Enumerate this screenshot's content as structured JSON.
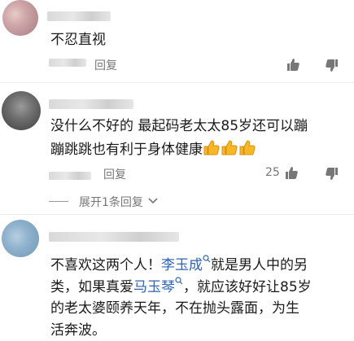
{
  "comments": [
    {
      "text_lines": [
        "不忍直视"
      ],
      "reply_label": "回复",
      "like_count": ""
    },
    {
      "text_lines": [
        "没什么不好的 最起码老太太85岁还可以蹦",
        "蹦跳跳也有利于身体健康"
      ],
      "reply_label": "回复",
      "like_count": "25",
      "emoji": [
        "thumbs-up",
        "thumbs-up",
        "thumbs-up"
      ]
    },
    {
      "line1_a": "不喜欢这两个人！",
      "mention1": "李玉成",
      "line1_b": "就是男人中的另",
      "line2_a": "类，如果真爱",
      "mention2": "马玉琴",
      "line2_b": "，就应该好好让85岁",
      "line3": "的老太婆颐养天年，不在抛头露面，为生",
      "line4": "活奔波。"
    }
  ],
  "expand_replies_label": "展开1条回复",
  "colors": {
    "link": "#2f63b5",
    "meta": "#777777"
  }
}
